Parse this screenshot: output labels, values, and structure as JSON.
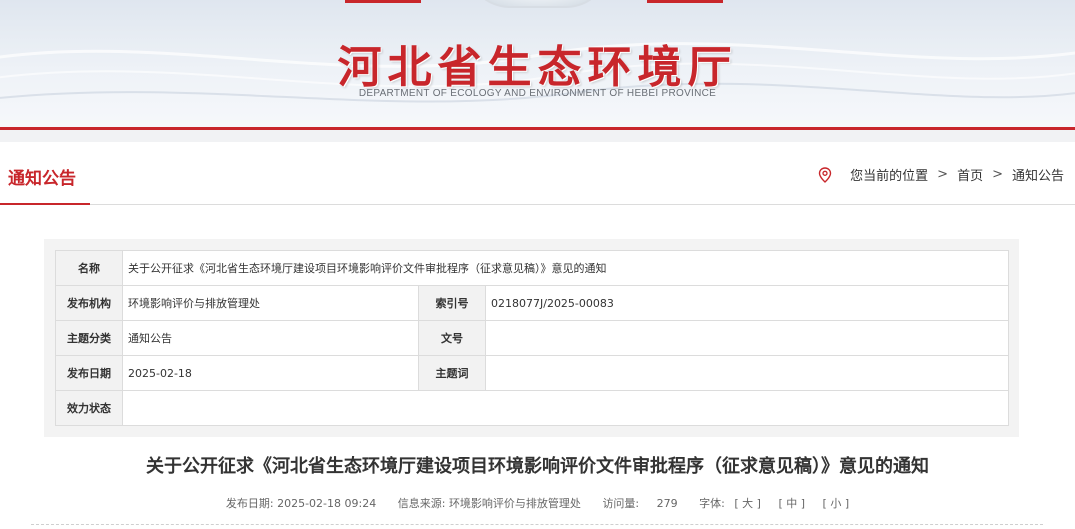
{
  "banner": {
    "title": "河北省生态环境厅",
    "subtitle": "DEPARTMENT OF ECOLOGY AND ENVIRONMENT OF HEBEI PROVINCE"
  },
  "column": {
    "title": "通知公告"
  },
  "breadcrumb": {
    "prefix": "您当前的位置",
    "separator": ">",
    "items": [
      "首页",
      "通知公告"
    ]
  },
  "info": {
    "labels": {
      "name": "名称",
      "publisher": "发布机构",
      "index": "索引号",
      "category": "主题分类",
      "doc_no": "文号",
      "date": "发布日期",
      "keywords": "主题词",
      "status": "效力状态"
    },
    "values": {
      "name": "关于公开征求《河北省生态环境厅建设项目环境影响评价文件审批程序（征求意见稿）》意见的通知",
      "publisher": "环境影响评价与排放管理处",
      "index": "0218077J/2025-00083",
      "category": "通知公告",
      "doc_no": "",
      "date": "2025-02-18",
      "keywords": "",
      "status": ""
    }
  },
  "article": {
    "title": "关于公开征求《河北省生态环境厅建设项目环境影响评价文件审批程序（征求意见稿）》意见的通知",
    "meta": {
      "date_label": "发布日期:",
      "date": "2025-02-18 09:24",
      "source_label": "信息来源:",
      "source": "环境影响评价与排放管理处",
      "views_label": "访问量:",
      "views": "279",
      "font_label": "字体:",
      "font_large": "[ 大 ]",
      "font_medium": "[ 中 ]",
      "font_small": "[ 小 ]"
    }
  },
  "colors": {
    "brand_red": "#c8262b",
    "border": "#dcdcdc"
  },
  "icons": {
    "breadcrumb": "location-pin-icon"
  }
}
